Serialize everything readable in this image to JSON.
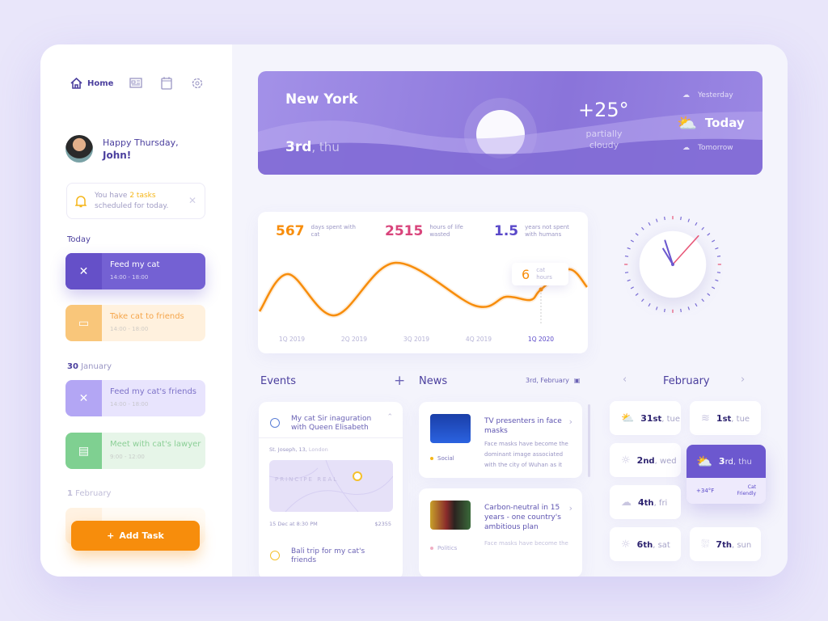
{
  "nav": {
    "home": "Home",
    "icons": [
      "home-icon",
      "news-icon",
      "calendar-icon",
      "gear-icon"
    ]
  },
  "greeting": {
    "line1": "Happy Thursday,",
    "line2": "John!"
  },
  "notice": {
    "prefix": "You have ",
    "highlight": "2 tasks",
    "suffix": "scheduled for today."
  },
  "sections": {
    "today": "Today",
    "jan_num": "30",
    "jan": "January",
    "feb_num": "1",
    "feb": "February"
  },
  "tasks": [
    {
      "title": "Feed my cat",
      "time": "14:00 - 18:00",
      "color": "#6f5cd0",
      "icon": "fork-knife-icon"
    },
    {
      "title": "Take cat to friends",
      "time": "14:00 - 18:00",
      "color": "#f9c67a",
      "icon": "car-icon"
    },
    {
      "title": "Feed my cat's friends",
      "time": "14:00 - 18:00",
      "color": "#b3a6f4",
      "icon": "fork-knife-icon"
    },
    {
      "title": "Meet with cat's lawyer",
      "time": "9:00 - 12:00",
      "color": "#7fd091",
      "icon": "document-icon"
    }
  ],
  "add_task": "Add Task",
  "weather": {
    "city": "New York",
    "date_num": "3rd",
    "date_day": ", thu",
    "temp": "+25°",
    "condition": "partially cloudy",
    "yesterday": "Yesterday",
    "today": "Today",
    "tomorrow": "Tomorrow"
  },
  "stats": [
    {
      "value": "567",
      "label": "days spent with cat",
      "color": "#f78d0c"
    },
    {
      "value": "2515",
      "label": "hours of life wasted",
      "color": "#d9457c"
    },
    {
      "value": "1.5",
      "label": "years not spent with humans",
      "color": "#5a49c9"
    }
  ],
  "chart_data": {
    "type": "line",
    "categories": [
      "1Q 2019",
      "2Q 2019",
      "3Q 2019",
      "4Q 2019",
      "1Q 2020"
    ],
    "x": [
      -0.52,
      -0.06,
      0.69,
      1.66,
      2.94,
      3.44,
      3.83,
      4.0,
      4.45,
      4.74
    ],
    "values": [
      3.3,
      7.9,
      2.8,
      9.3,
      4.0,
      5.1,
      4.7,
      6.0,
      8.5,
      6.3
    ],
    "highlight": {
      "category": "1Q 2020",
      "value": "6",
      "label": "cat hours"
    },
    "color": "#f78d0c",
    "grid": false
  },
  "clock": {
    "time": "10:57:07"
  },
  "events": {
    "title": "Events",
    "items": [
      {
        "title": "My cat Sir inaguration with Queen Elisabeth",
        "address_bold": "St. Joseph, 13,",
        "address_city": " London",
        "map_label": "PRINCIPE REAL",
        "date": "15 Dec at 8:30 PM",
        "price": "$2355"
      },
      {
        "title": "Bali trip for my cat's friends"
      }
    ]
  },
  "news": {
    "title": "News",
    "date": "3rd, February",
    "items": [
      {
        "title": "TV presenters in face masks",
        "desc": "Face masks have become the dominant image associated with the city of Wuhan as it",
        "tag": "Social",
        "tag_color": "#f5b619"
      },
      {
        "title": "Carbon-neutral in 15 years - one country's ambitious plan",
        "desc": "Face masks have become the",
        "tag": "Politics",
        "tag_color": "#e57b9c"
      }
    ]
  },
  "calendar": {
    "month": "February",
    "days": [
      {
        "num": "31",
        "suf": "st",
        "wd": ", tue",
        "icon": "sun-cloud-icon"
      },
      {
        "num": "1",
        "suf": "st",
        "wd": ", tue",
        "icon": "fog-icon"
      },
      {
        "num": "2",
        "suf": "nd",
        "wd": ", wed",
        "icon": "sun-icon"
      },
      {
        "num": "3",
        "suf": "rd",
        "wd": ", thu",
        "icon": "sun-cloud-icon",
        "temp": "+34°F",
        "note": "Cat Friendly"
      },
      {
        "num": "4",
        "suf": "th",
        "wd": ", fri",
        "icon": "cloud-icon"
      },
      {
        "num": "6",
        "suf": "th",
        "wd": ", sat",
        "icon": "sun-icon"
      },
      {
        "num": "7",
        "suf": "th",
        "wd": ", sun",
        "icon": "rain-cloud-icon"
      }
    ]
  }
}
